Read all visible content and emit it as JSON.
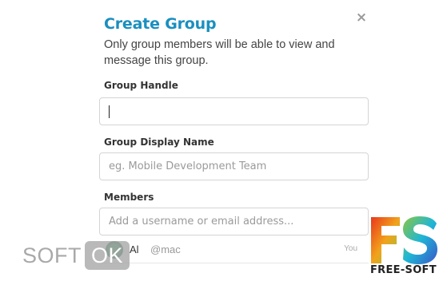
{
  "dialog": {
    "title": "Create Group",
    "close_glyph": "×",
    "subtitle": "Only group members will be able to view and message this group."
  },
  "form": {
    "handle_label": "Group Handle",
    "handle_value": "",
    "display_label": "Group Display Name",
    "display_placeholder": "eg. Mobile Development Team",
    "members_label": "Members",
    "members_placeholder": "Add a username or email address..."
  },
  "members": [
    {
      "name": "Al",
      "handle": "@mac",
      "tag": "You",
      "avatar_icon": "user-avatar-icon"
    }
  ],
  "watermarks": {
    "left_text": "SOFT",
    "left_badge": "OK",
    "right_logo_letters": "FS",
    "right_text": "FREE-SOFT"
  },
  "colors": {
    "title": "#1a8fbf",
    "logo_f": "#f2a21b",
    "logo_s": "#1fb6d6"
  }
}
